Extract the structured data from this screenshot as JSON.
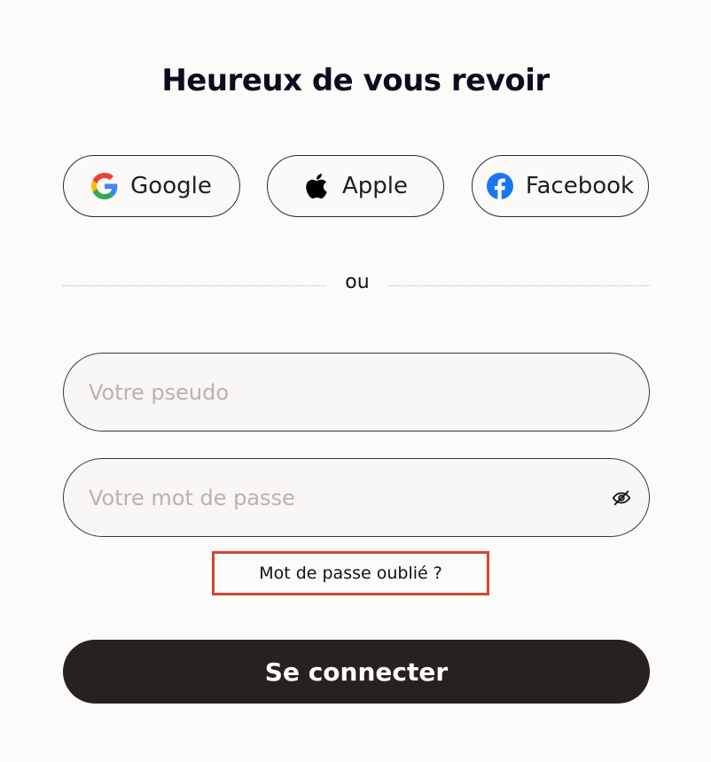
{
  "heading": "Heureux de vous revoir",
  "social": {
    "google": {
      "label": "Google",
      "icon": "google-icon"
    },
    "apple": {
      "label": "Apple",
      "icon": "apple-icon"
    },
    "facebook": {
      "label": "Facebook",
      "icon": "facebook-icon"
    }
  },
  "divider_text": "ou",
  "fields": {
    "pseudo": {
      "placeholder": "Votre pseudo",
      "value": ""
    },
    "password": {
      "placeholder": "Votre mot de passe",
      "value": "",
      "toggle_icon": "eye-slash-icon"
    }
  },
  "forgot_link": "Mot de passe oublié ?",
  "submit_label": "Se connecter",
  "colors": {
    "background": "#fcfbf9",
    "primary_button": "#252220",
    "highlight_border": "#d4452f",
    "placeholder": "#bcb2a8",
    "facebook_blue": "#1877f2"
  }
}
